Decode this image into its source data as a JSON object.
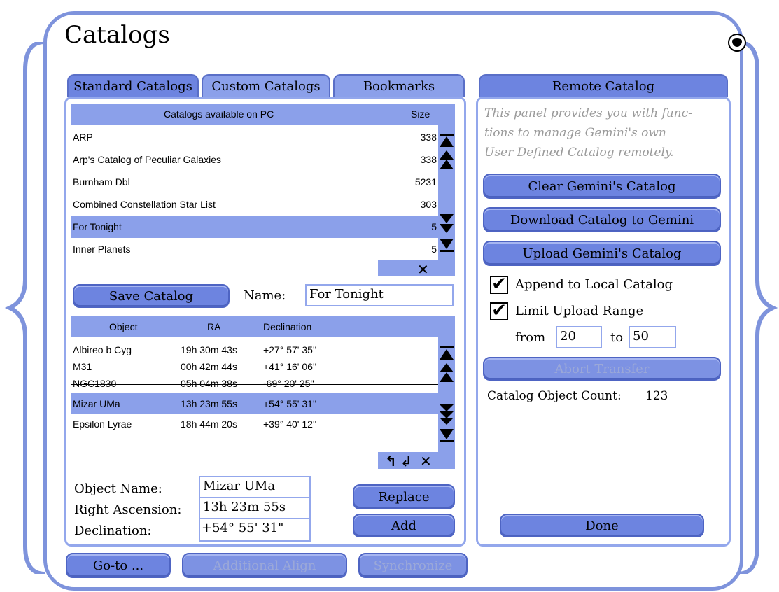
{
  "window": {
    "title": "Catalogs"
  },
  "tabs": [
    {
      "label": "Standard Catalogs"
    },
    {
      "label": "Custom Catalogs"
    },
    {
      "label": "Bookmarks"
    }
  ],
  "catalog_list": {
    "header": {
      "name": "Catalogs available on PC",
      "size": "Size"
    },
    "rows": [
      {
        "name": "ARP",
        "size": "338"
      },
      {
        "name": "Arp's Catalog of Peculiar Galaxies",
        "size": "338"
      },
      {
        "name": "Burnham Dbl",
        "size": "5231"
      },
      {
        "name": "Combined Constellation Star List",
        "size": "303"
      },
      {
        "name": "For Tonight",
        "size": "5"
      },
      {
        "name": "Inner Planets",
        "size": "5"
      }
    ]
  },
  "save": {
    "button": "Save Catalog",
    "name_label": "Name:",
    "name_value": "For Tonight"
  },
  "objects": {
    "headers": {
      "object": "Object",
      "ra": "RA",
      "dec": "Declination"
    },
    "rows": [
      {
        "object": "Albireo b Cyg",
        "ra": "19h 30m 43s",
        "dec": "+27° 57' 35''"
      },
      {
        "object": "M31",
        "ra": "00h 42m 44s",
        "dec": "+41° 16' 06''"
      },
      {
        "object": "NGC1830",
        "ra": "05h 04m 38s",
        "dec": "-69° 20' 25''"
      },
      {
        "object": "Mizar UMa",
        "ra": "13h 23m 55s",
        "dec": "+54° 55' 31''"
      },
      {
        "object": "Epsilon Lyrae",
        "ra": "18h 44m 20s",
        "dec": "+39° 40' 12''"
      }
    ]
  },
  "editor": {
    "object_name_label": "Object Name:",
    "object_name_value": "Mizar UMa",
    "ra_label": "Right Ascension:",
    "ra_value": "13h 23m 55s",
    "dec_label": "Declination:",
    "dec_value": "+54° 55' 31\"",
    "replace_button": "Replace",
    "add_button": "Add"
  },
  "bottom": {
    "goto": "Go-to ...",
    "align": "Additional Align",
    "sync": "Synchronize"
  },
  "remote": {
    "tab": "Remote Catalog",
    "info_1": "This panel provides you with func-",
    "info_2": "tions to manage Gemini's own",
    "info_3": "User Defined Catalog remotely.",
    "clear": "Clear Gemini's Catalog",
    "download": "Download Catalog to Gemini",
    "upload": "Upload Gemini's Catalog",
    "append_label": "Append to Local Catalog",
    "append_checked": "✔",
    "limit_label": "Limit Upload Range",
    "limit_checked": "✔",
    "from_label": "from",
    "from_value": "20",
    "to_label": "to",
    "to_value": "50",
    "abort": "Abort Transfer",
    "count_label": "Catalog Object Count:",
    "count_value": "123",
    "done": "Done"
  },
  "icons": {
    "scroll_top": "⏫",
    "page_up": "▲",
    "page_down": "▼",
    "scroll_bottom": "⏬",
    "delete": "✕",
    "move_up": "↰",
    "move_down": "↲"
  }
}
